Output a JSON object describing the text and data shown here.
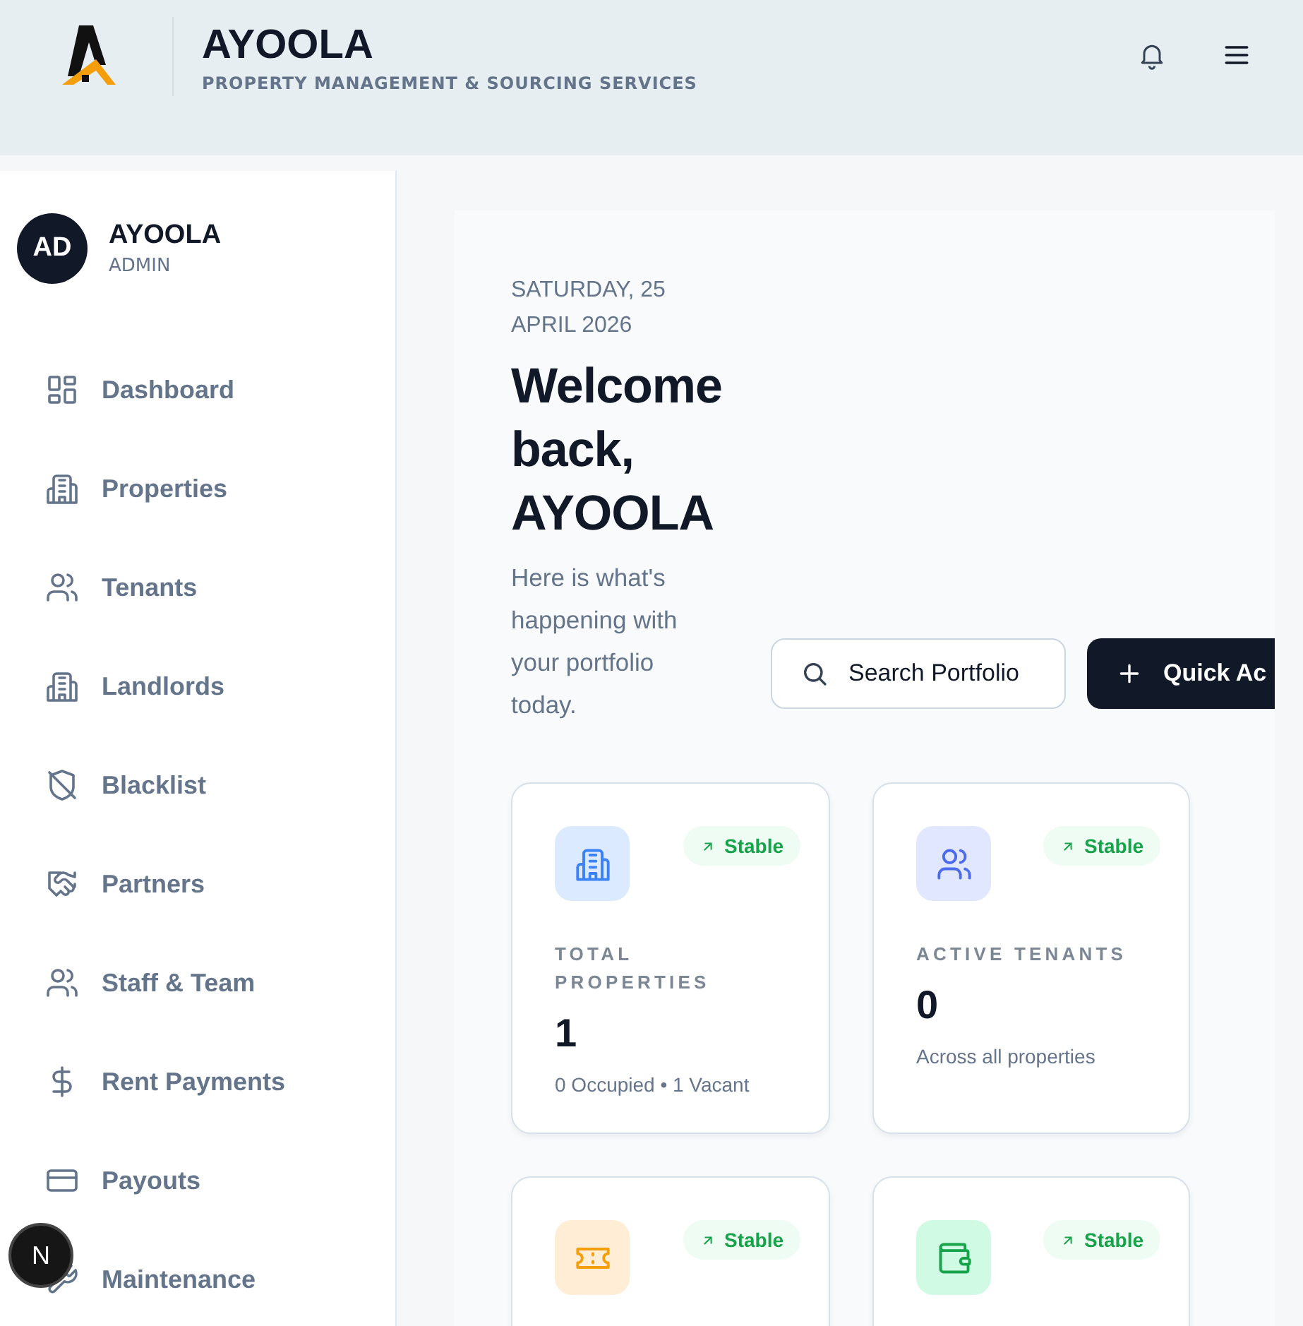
{
  "header": {
    "brand": "AYOOLA",
    "tagline": "PROPERTY MANAGEMENT & SOURCING SERVICES"
  },
  "user": {
    "initials": "AD",
    "name": "AYOOLA",
    "role": "ADMIN"
  },
  "sidebar": {
    "items": [
      {
        "label": "Dashboard",
        "kind": "grid"
      },
      {
        "label": "Properties",
        "kind": "building"
      },
      {
        "label": "Tenants",
        "kind": "users"
      },
      {
        "label": "Landlords",
        "kind": "building"
      },
      {
        "label": "Blacklist",
        "kind": "shield"
      },
      {
        "label": "Partners",
        "kind": "handshake"
      },
      {
        "label": "Staff & Team",
        "kind": "users"
      },
      {
        "label": "Rent Payments",
        "kind": "dollar"
      },
      {
        "label": "Payouts",
        "kind": "card"
      },
      {
        "label": "Maintenance",
        "kind": "wrench"
      }
    ]
  },
  "main": {
    "date": "SATURDAY, 25 APRIL 2026",
    "heading": "Welcome back, AYOOLA",
    "subtitle": "Here is what's happening with your portfolio today.",
    "search_button": "Search Portfolio",
    "action_button": "Quick Ac"
  },
  "stats": [
    {
      "kind": "building",
      "badge": "Stable",
      "label": "TOTAL PROPERTIES",
      "value": "1",
      "note": "0 Occupied • 1 Vacant"
    },
    {
      "kind": "users",
      "badge": "Stable",
      "label": "ACTIVE TENANTS",
      "value": "0",
      "note": "Across all properties"
    },
    {
      "kind": "ticket",
      "badge": "Stable"
    },
    {
      "kind": "wallet",
      "badge": "Stable"
    }
  ],
  "dev_badge": "N"
}
